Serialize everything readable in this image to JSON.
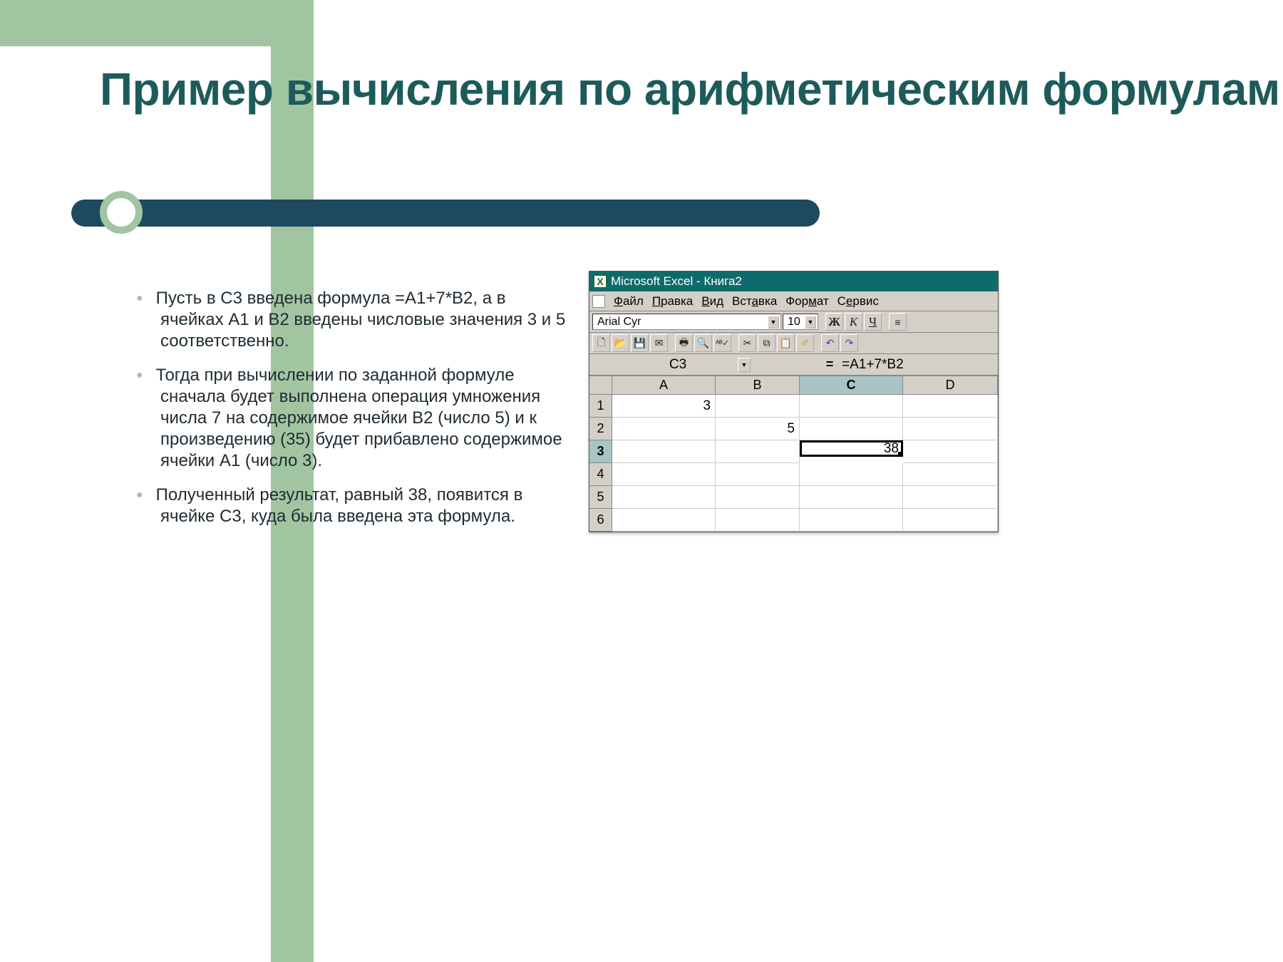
{
  "slide": {
    "title": "Пример вычисления по арифметическим формулам",
    "bullets": [
      "Пусть в С3 введена формула =А1+7*В2, а в ячейках А1 и В2 введены числовые значения 3 и 5 соответственно.",
      "Тогда при вычислении по заданной формуле сначала будет выполнена операция умножения числа 7 на содержимое ячейки В2 (число 5) и к произведению (35) будет прибавлено содержимое ячейки А1 (число 3).",
      "Полученный результат, равный 38, появится в ячейке С3, куда была введена эта формула."
    ]
  },
  "excel": {
    "title": "Microsoft Excel - Книга2",
    "menu": [
      "Файл",
      "Правка",
      "Вид",
      "Вставка",
      "Формат",
      "Сервис"
    ],
    "font": "Arial Cyr",
    "fontSize": "10",
    "bold": "Ж",
    "italic": "К",
    "uline": "Ч",
    "nameBox": "C3",
    "formula": "=A1+7*B2",
    "columns": [
      "A",
      "B",
      "C",
      "D"
    ],
    "rows": [
      "1",
      "2",
      "3",
      "4",
      "5",
      "6"
    ],
    "activeRow": "3",
    "activeCol": "C",
    "cells": {
      "A1": "3",
      "B2": "5",
      "C3": "38"
    }
  }
}
